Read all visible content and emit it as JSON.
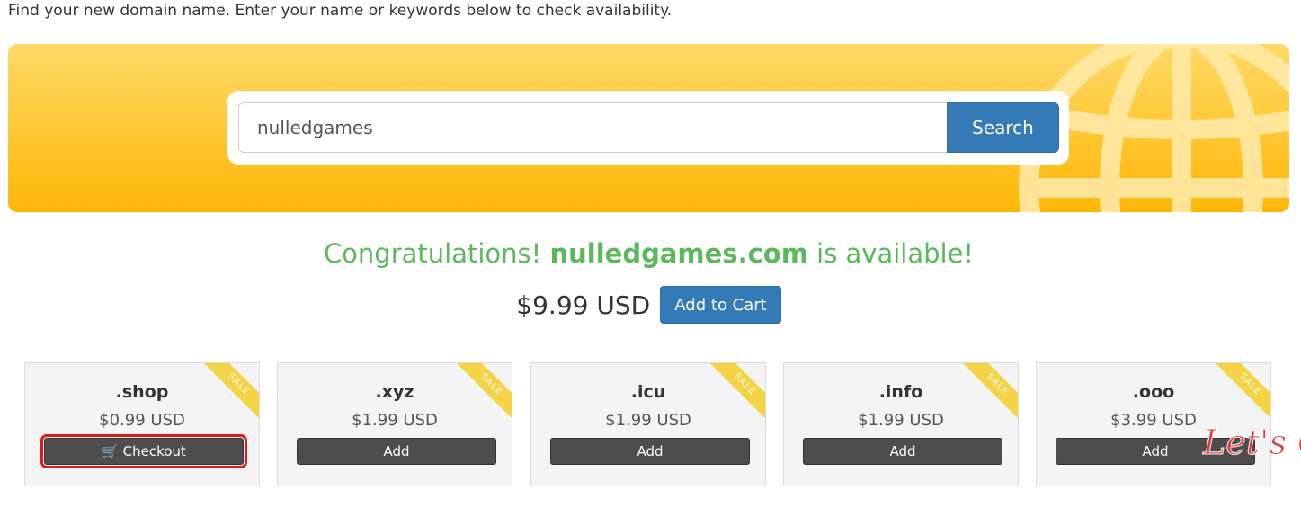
{
  "intro": "Find your new domain name. Enter your name or keywords below to check availability.",
  "search": {
    "value": "nulledgames",
    "button_label": "Search"
  },
  "result": {
    "prefix": "Congratulations! ",
    "domain": "nulledgames.com",
    "suffix": " is available!",
    "price": "$9.99 USD",
    "add_to_cart_label": "Add to Cart"
  },
  "suggestions": [
    {
      "tld": ".shop",
      "price": "$0.99 USD",
      "button": "Checkout",
      "badge": "SALE"
    },
    {
      "tld": ".xyz",
      "price": "$1.99 USD",
      "button": "Add",
      "badge": "SALE"
    },
    {
      "tld": ".icu",
      "price": "$1.99 USD",
      "button": "Add",
      "badge": "SALE"
    },
    {
      "tld": ".info",
      "price": "$1.99 USD",
      "button": "Add",
      "badge": "SALE"
    },
    {
      "tld": ".ooo",
      "price": "$3.99 USD",
      "button": "Add",
      "badge": "SALE"
    }
  ],
  "chat_widget": {
    "label": "Let's Chat",
    "color": "#e0373a"
  },
  "colors": {
    "primary": "#337ab7",
    "success": "#5cb85c",
    "banner": "#ffc631",
    "sale": "#f5d347"
  }
}
